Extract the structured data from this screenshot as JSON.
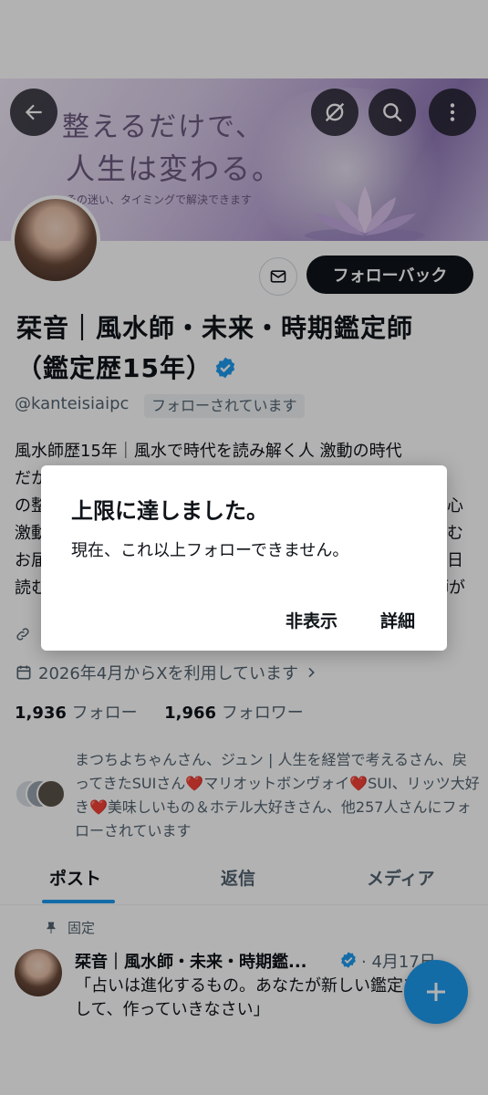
{
  "banner": {
    "title_line1": "整えるだけで、",
    "title_line2": "人生は変わる。",
    "subtitle": "その迷い、タイミングで解決できます"
  },
  "header_buttons": {
    "back_icon": "arrow-left-icon",
    "unfollow_icon": "slashed-circle-icon",
    "search_icon": "search-icon",
    "more_icon": "more-vertical-icon"
  },
  "profile": {
    "name_line1": "栞音｜風水師・未来・時期鑑定師",
    "name_line2": "（鑑定歴15年）",
    "handle": "@kanteisiaipc",
    "follows_you": "フォローされています",
    "follow_back_label": "フォローバック",
    "bio_lines": [
      "風水師歴15年｜風水で時代を読み解く人  激動の時代",
      "だか",
      "の整",
      "激動",
      "お届",
      "読む"
    ],
    "bio_right_fragments": [
      "心",
      "む",
      "日",
      "師が"
    ],
    "joined": "2026年4月からXを利用しています",
    "following_count": "1,936",
    "following_label": "フォロー",
    "followers_count": "1,966",
    "followers_label": "フォロワー",
    "followed_by_text": "まつちよちゃんさん、ジュン | 人生を経営で考えるさん、戻ってきたSUIさん❤️マリオットボンヴォイ❤️SUI、リッツ大好き❤️美味しいもの＆ホテル大好きさん、他257人さんにフォローされています"
  },
  "tabs": [
    {
      "label": "ポスト",
      "active": true
    },
    {
      "label": "返信",
      "active": false
    },
    {
      "label": "メディア",
      "active": false
    }
  ],
  "pinned_label": "固定",
  "post": {
    "author": "栞音｜風水師・未来・時期鑑...",
    "date": "· 4月17日",
    "text": "「占いは進化するもの。あなたが新しい鑑定を更新して、作っていきなさい」"
  },
  "dialog": {
    "title": "上限に達しました。",
    "message": "現在、これ以上フォローできません。",
    "hide_label": "非表示",
    "details_label": "詳細"
  },
  "colors": {
    "accent": "#1d9bf0",
    "text_primary": "#0f1419",
    "text_secondary": "#536471"
  }
}
